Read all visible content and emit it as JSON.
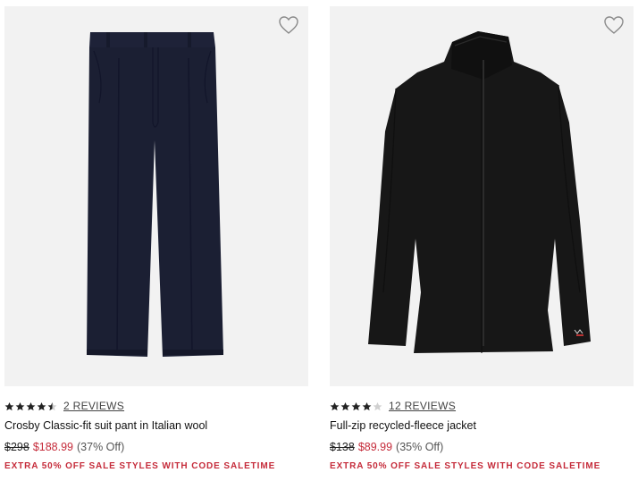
{
  "colors": {
    "sale_red": "#c52b3a",
    "image_bg": "#f2f2f2",
    "star": "#222222"
  },
  "products": [
    {
      "image_desc": "navy suit pant",
      "wishlist_icon": "heart-outline-icon",
      "rating": 4.5,
      "reviews_label": "2 REVIEWS",
      "title": "Crosby Classic-fit suit pant in Italian wool",
      "original_price": "$298",
      "sale_price": "$188.99",
      "discount": "(37% Off)",
      "promo": "EXTRA 50% OFF SALE STYLES WITH CODE SALETIME"
    },
    {
      "image_desc": "black fleece jacket",
      "wishlist_icon": "heart-outline-icon",
      "rating": 4,
      "reviews_label": "12 REVIEWS",
      "title": "Full-zip recycled-fleece jacket",
      "original_price": "$138",
      "sale_price": "$89.99",
      "discount": "(35% Off)",
      "promo": "EXTRA 50% OFF SALE STYLES WITH CODE SALETIME"
    }
  ]
}
